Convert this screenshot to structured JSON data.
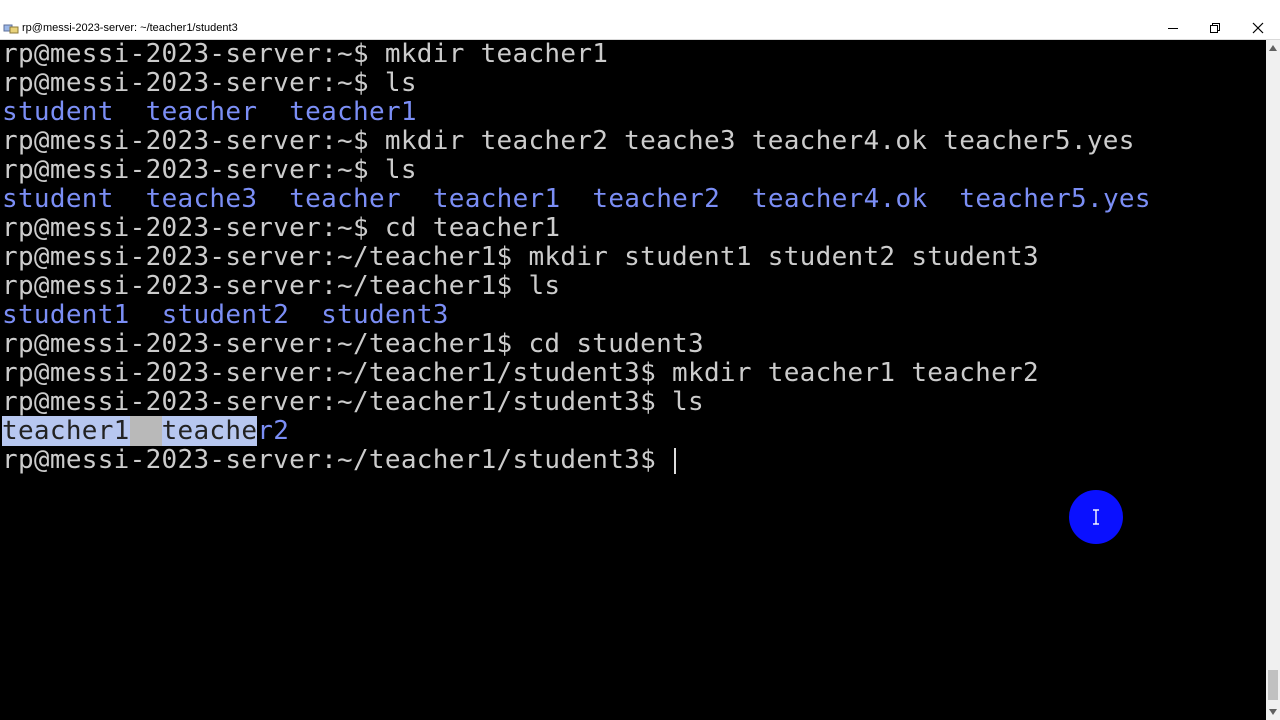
{
  "window": {
    "title": "rp@messi-2023-server: ~/teacher1/student3",
    "app_icon": "putty-icon",
    "controls": [
      "minimize-icon",
      "restore-icon",
      "close-icon"
    ]
  },
  "terminal": {
    "lines": [
      {
        "segments": [
          {
            "text": "rp@messi-2023-server:~$ mkdir teacher1",
            "style": "plain"
          }
        ]
      },
      {
        "segments": [
          {
            "text": "rp@messi-2023-server:~$ ls",
            "style": "plain"
          }
        ]
      },
      {
        "segments": [
          {
            "text": "student",
            "style": "dir"
          },
          {
            "text": "  ",
            "style": "plain"
          },
          {
            "text": "teacher",
            "style": "dir"
          },
          {
            "text": "  ",
            "style": "plain"
          },
          {
            "text": "teacher1",
            "style": "dir"
          }
        ]
      },
      {
        "segments": [
          {
            "text": "rp@messi-2023-server:~$ mkdir teacher2 teache3 teacher4.ok teacher5.yes",
            "style": "plain"
          }
        ]
      },
      {
        "segments": [
          {
            "text": "rp@messi-2023-server:~$ ls",
            "style": "plain"
          }
        ]
      },
      {
        "segments": [
          {
            "text": "student",
            "style": "dir"
          },
          {
            "text": "  ",
            "style": "plain"
          },
          {
            "text": "teache3",
            "style": "dir"
          },
          {
            "text": "  ",
            "style": "plain"
          },
          {
            "text": "teacher",
            "style": "dir"
          },
          {
            "text": "  ",
            "style": "plain"
          },
          {
            "text": "teacher1",
            "style": "dir"
          },
          {
            "text": "  ",
            "style": "plain"
          },
          {
            "text": "teacher2",
            "style": "dir"
          },
          {
            "text": "  ",
            "style": "plain"
          },
          {
            "text": "teacher4.ok",
            "style": "dir"
          },
          {
            "text": "  ",
            "style": "plain"
          },
          {
            "text": "teacher5.yes",
            "style": "dir"
          }
        ]
      },
      {
        "segments": [
          {
            "text": "rp@messi-2023-server:~$ cd teacher1",
            "style": "plain"
          }
        ]
      },
      {
        "segments": [
          {
            "text": "rp@messi-2023-server:~/teacher1$ mkdir student1 student2 student3",
            "style": "plain"
          }
        ]
      },
      {
        "segments": [
          {
            "text": "rp@messi-2023-server:~/teacher1$ ls",
            "style": "plain"
          }
        ]
      },
      {
        "segments": [
          {
            "text": "student1",
            "style": "dir"
          },
          {
            "text": "  ",
            "style": "plain"
          },
          {
            "text": "student2",
            "style": "dir"
          },
          {
            "text": "  ",
            "style": "plain"
          },
          {
            "text": "student3",
            "style": "dir"
          }
        ]
      },
      {
        "segments": [
          {
            "text": "rp@messi-2023-server:~/teacher1$ cd student3",
            "style": "plain"
          }
        ]
      },
      {
        "segments": [
          {
            "text": "rp@messi-2023-server:~/teacher1/student3$ mkdir teacher1 teacher2",
            "style": "plain"
          }
        ]
      },
      {
        "segments": [
          {
            "text": "rp@messi-2023-server:~/teacher1/student3$ ls",
            "style": "plain"
          }
        ]
      },
      {
        "segments": [
          {
            "text": "teacher1",
            "style": "sel"
          },
          {
            "text": "  ",
            "style": "sel-gap"
          },
          {
            "text": "teache",
            "style": "sel"
          },
          {
            "text": "r2",
            "style": "dir"
          }
        ]
      },
      {
        "segments": [
          {
            "text": "rp@messi-2023-server:~/teacher1/student3$ ",
            "style": "plain"
          }
        ],
        "cursor": true
      }
    ]
  },
  "colors": {
    "background": "#000000",
    "text": "#cccccc",
    "directory": "#7b8ef5",
    "selection": "#b7c7f0",
    "mouse_indicator": "#0a10ff"
  },
  "mouse_indicator": {
    "icon": "text-cursor-icon"
  }
}
